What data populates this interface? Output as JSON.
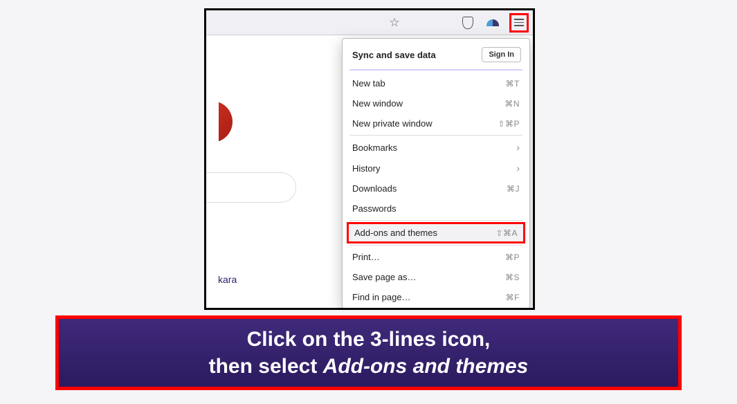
{
  "toolbar": {
    "icons": [
      "star",
      "shield",
      "extension",
      "menu"
    ]
  },
  "menu": {
    "sync_label": "Sync and save data",
    "sign_in": "Sign In",
    "items": [
      {
        "label": "New tab",
        "shortcut": "⌘T"
      },
      {
        "label": "New window",
        "shortcut": "⌘N"
      },
      {
        "label": "New private window",
        "shortcut": "⇧⌘P"
      }
    ],
    "items2": [
      {
        "label": "Bookmarks",
        "chevron": true
      },
      {
        "label": "History",
        "chevron": true
      },
      {
        "label": "Downloads",
        "shortcut": "⌘J"
      },
      {
        "label": "Passwords"
      }
    ],
    "highlight": {
      "label": "Add-ons and themes",
      "shortcut": "⇧⌘A"
    },
    "items3": [
      {
        "label": "Print…",
        "shortcut": "⌘P"
      },
      {
        "label": "Save page as…",
        "shortcut": "⌘S"
      },
      {
        "label": "Find in page…",
        "shortcut": "⌘F"
      }
    ]
  },
  "bg_text": "kara",
  "caption": {
    "line1": "Click on the 3-lines icon,",
    "line2_a": "then select ",
    "line2_b": "Add-ons and themes"
  }
}
